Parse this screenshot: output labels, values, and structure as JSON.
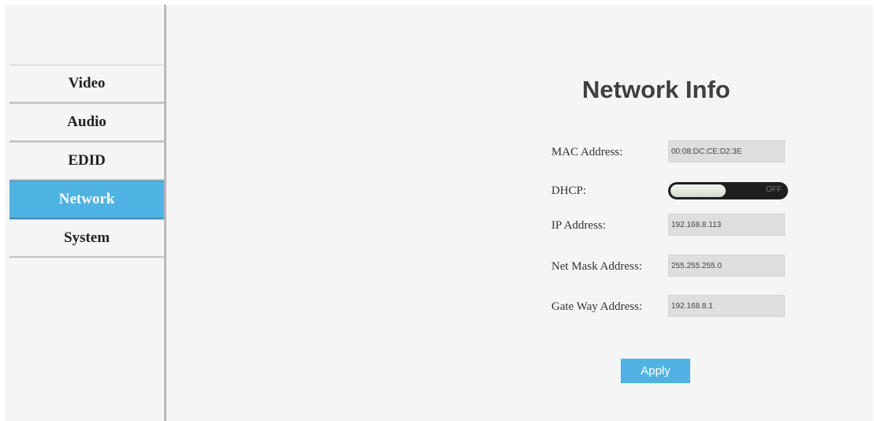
{
  "sidebar": {
    "items": [
      {
        "label": "Video"
      },
      {
        "label": "Audio"
      },
      {
        "label": "EDID"
      },
      {
        "label": "Network",
        "active": true
      },
      {
        "label": "System"
      }
    ]
  },
  "main": {
    "title": "Network Info",
    "fields": {
      "mac": {
        "label": "MAC Address:",
        "value": "00:08:DC:CE:D2:3E"
      },
      "dhcp": {
        "label": "DHCP:",
        "state": "OFF"
      },
      "ip": {
        "label": "IP Address:",
        "value": "192.168.8.113"
      },
      "netmask": {
        "label": "Net Mask Address:",
        "value": "255.255.255.0"
      },
      "gateway": {
        "label": "Gate Way Address:",
        "value": "192.168.8.1"
      }
    },
    "apply_label": "Apply"
  },
  "colors": {
    "accent": "#4fb3e2",
    "toggle_bg": "#1e1e1e"
  }
}
